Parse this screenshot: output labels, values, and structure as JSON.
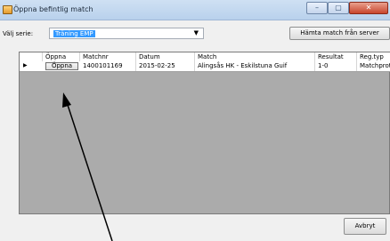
{
  "window": {
    "title": "Öppna befintlig match",
    "min_glyph": "–",
    "max_glyph": "▢",
    "close_glyph": "✕"
  },
  "form": {
    "series_label": "Välj serie:",
    "series_value": "Träning EMP",
    "fetch_button": "Hämta match från server"
  },
  "grid": {
    "columns": [
      "Öppna",
      "Matchnr",
      "Datum",
      "Match",
      "Resultat",
      "Reg.typ"
    ],
    "rows": [
      {
        "open_button": "Öppna",
        "matchnr": "1400101169",
        "datum": "2015-02-25",
        "match": "Alingsås HK - Eskilstuna Guif",
        "resultat": "1-0",
        "regtyp": "Matchprotokoll"
      }
    ]
  },
  "footer": {
    "cancel_button": "Avbryt"
  },
  "colors": {
    "selection": "#3399ff",
    "grid_background": "#ababab",
    "annotation_arrow": "#000000"
  },
  "icons": [
    "app-icon",
    "minimize-icon",
    "maximize-icon",
    "close-icon",
    "dropdown-arrow-icon",
    "row-indicator-icon"
  ]
}
